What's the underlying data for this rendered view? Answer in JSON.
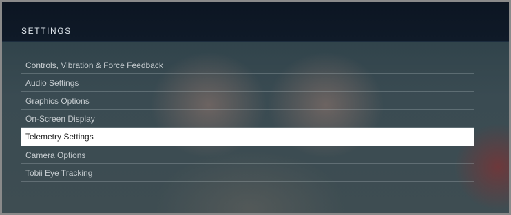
{
  "header": {
    "title": "SETTINGS"
  },
  "menu": {
    "selected_index": 4,
    "items": [
      {
        "label": "Controls, Vibration & Force Feedback"
      },
      {
        "label": "Audio Settings"
      },
      {
        "label": "Graphics Options"
      },
      {
        "label": "On-Screen Display"
      },
      {
        "label": "Telemetry Settings"
      },
      {
        "label": "Camera Options"
      },
      {
        "label": "Tobii Eye Tracking"
      }
    ]
  },
  "colors": {
    "header_bg": "#0c1522",
    "selected_bg": "#ffffff",
    "item_text": "#c6ccd0",
    "selected_text": "#1e1e1e"
  }
}
